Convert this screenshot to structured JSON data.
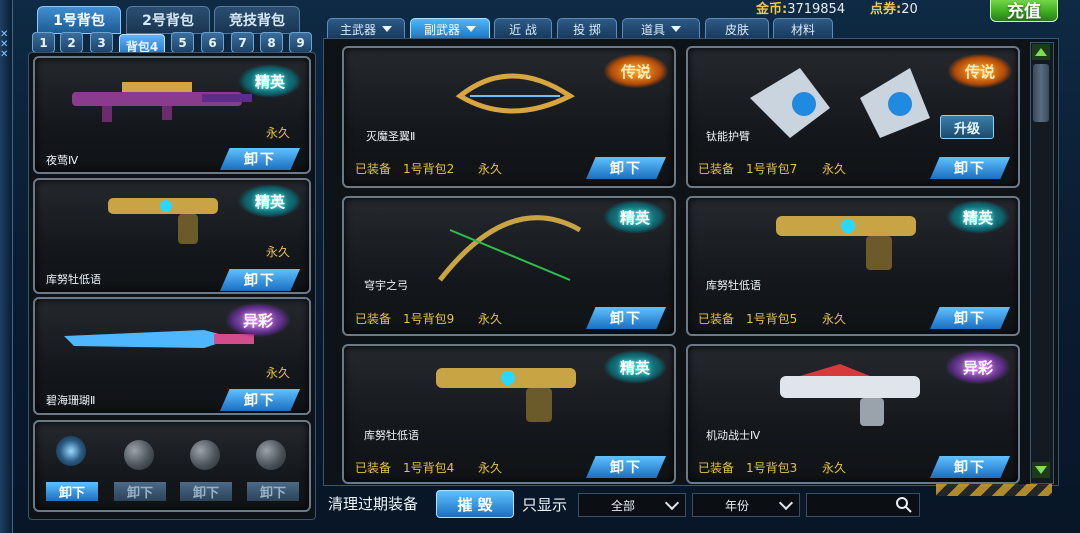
{
  "header": {
    "gold_label": "金币:",
    "gold_value": "3719854",
    "points_label": "点券:",
    "points_value": "20",
    "recharge_label": "充值"
  },
  "bag_tabs": [
    "1号背包",
    "2号背包",
    "竞技背包"
  ],
  "number_tabs": [
    "1",
    "2",
    "3",
    "背包4",
    "5",
    "6",
    "7",
    "8",
    "9"
  ],
  "category_tabs": [
    "主武器",
    "副武器",
    "近 战",
    "投 掷",
    "道具",
    "皮肤",
    "材料"
  ],
  "left_items": [
    {
      "name": "夜莺Ⅳ",
      "badge": "精英",
      "duration": "永久",
      "button": "卸下"
    },
    {
      "name": "库努牡低语",
      "badge": "精英",
      "duration": "永久",
      "button": "卸下"
    },
    {
      "name": "碧海珊瑚Ⅱ",
      "badge": "异彩",
      "duration": "永久",
      "button": "卸下"
    }
  ],
  "throw_slots": {
    "buttons": [
      "卸下",
      "卸下",
      "卸下",
      "卸下"
    ]
  },
  "grid_items": [
    {
      "name": "灭魔圣翼Ⅱ",
      "badge": "传说",
      "equipped": "已装备",
      "bag": "1号背包2",
      "duration": "永久",
      "button": "卸下"
    },
    {
      "name": "钛能护臂",
      "badge": "传说",
      "equipped": "已装备",
      "bag": "1号背包7",
      "duration": "永久",
      "button": "卸下",
      "upgrade": "升级"
    },
    {
      "name": "穹宇之弓",
      "badge": "精英",
      "equipped": "已装备",
      "bag": "1号背包9",
      "duration": "永久",
      "button": "卸下"
    },
    {
      "name": "库努牡低语",
      "badge": "精英",
      "equipped": "已装备",
      "bag": "1号背包5",
      "duration": "永久",
      "button": "卸下"
    },
    {
      "name": "库努牡低语",
      "badge": "精英",
      "equipped": "已装备",
      "bag": "1号背包4",
      "duration": "永久",
      "button": "卸下"
    },
    {
      "name": "机动战士Ⅳ",
      "badge": "异彩",
      "equipped": "已装备",
      "bag": "1号背包3",
      "duration": "永久",
      "button": "卸下"
    }
  ],
  "bottom": {
    "clear_label": "清理过期装备",
    "destroy_label": "摧 毁",
    "only_show_label": "只显示",
    "filter_all": "全部",
    "filter_year": "年份",
    "search_value": ""
  },
  "colors": {
    "accent_blue": "#1b6fc0",
    "gold_text": "#e6c24b",
    "recharge_green": "#3fae22"
  }
}
